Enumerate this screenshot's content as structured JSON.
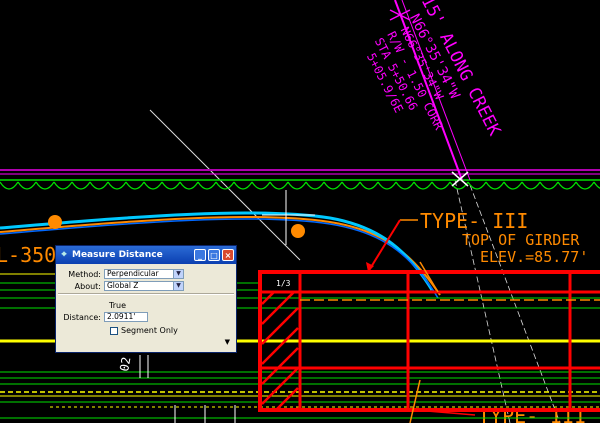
{
  "drawing": {
    "annotation_upper": "15' ALONG CREEK",
    "annotation_bearing": "N66°35'34\"W",
    "annotation_bearing2": "N66°35'34\"W",
    "annotation_corr": "R/W - 1.50 CORR",
    "annotation_sta": "STA 5+50.66",
    "annotation_nums": "5+05.9/6E",
    "label_left": "L-350",
    "type_label": "TYPE- III",
    "top_of_girder": "TOP OF GIRDER",
    "elev": "ELEV.=85.77'",
    "type_label_bottom": "TYPE- III",
    "small_label": "02",
    "small_label2": "1/3",
    "colors": {
      "background": "#000000",
      "green": "#00e000",
      "magenta": "#ff00ff",
      "orange": "#ff8a00",
      "red": "#ff0000",
      "cyan": "#00c8ff",
      "yellow": "#ffff00"
    }
  },
  "dialog": {
    "title": "Measure Distance",
    "method_label": "Method:",
    "method_value": "Perpendicular",
    "about_label": "About:",
    "about_value": "Global Z",
    "true_label": "True",
    "distance_label": "Distance:",
    "distance_value": "2.0911'",
    "segment_only_label": "Segment Only",
    "minimize": "_",
    "maximize": "□",
    "close": "×",
    "more_arrow": "▼"
  }
}
